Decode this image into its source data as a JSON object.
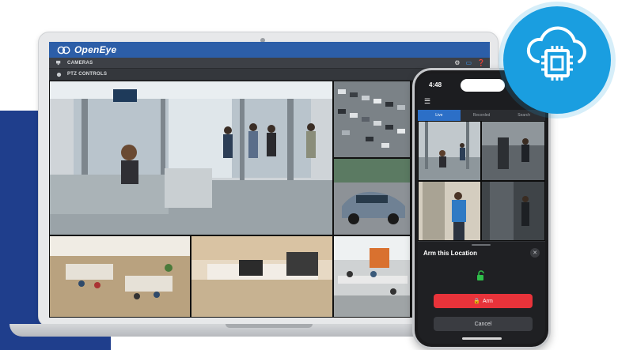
{
  "brand": {
    "name": "OpenEye",
    "accent": "#2c5ea8",
    "badge_color": "#1a9ee0",
    "panel_color": "#1f3e8c"
  },
  "laptop": {
    "menu": [
      {
        "label": "CAMERAS",
        "icon": "camera-icon"
      },
      {
        "label": "PTZ CONTROLS",
        "icon": "ptz-icon"
      }
    ],
    "toolbar_icons": [
      "gear-icon",
      "chat-icon",
      "help-icon"
    ],
    "camera_tiles": [
      {
        "scene": "lobby-reception"
      },
      {
        "scene": "parking-lot"
      },
      {
        "scene": "car-driveway"
      },
      {
        "scene": "office-workspace"
      },
      {
        "scene": "coffee-bar"
      },
      {
        "scene": "open-office"
      }
    ]
  },
  "phone": {
    "time": "4:48",
    "tabs": [
      "Live",
      "Recorded",
      "Search"
    ],
    "active_tab": "Live",
    "sheet": {
      "title": "Arm this Location",
      "arm_label": "Arm",
      "cancel_label": "Cancel"
    }
  },
  "badge": {
    "icon": "cloud-chip-icon"
  }
}
